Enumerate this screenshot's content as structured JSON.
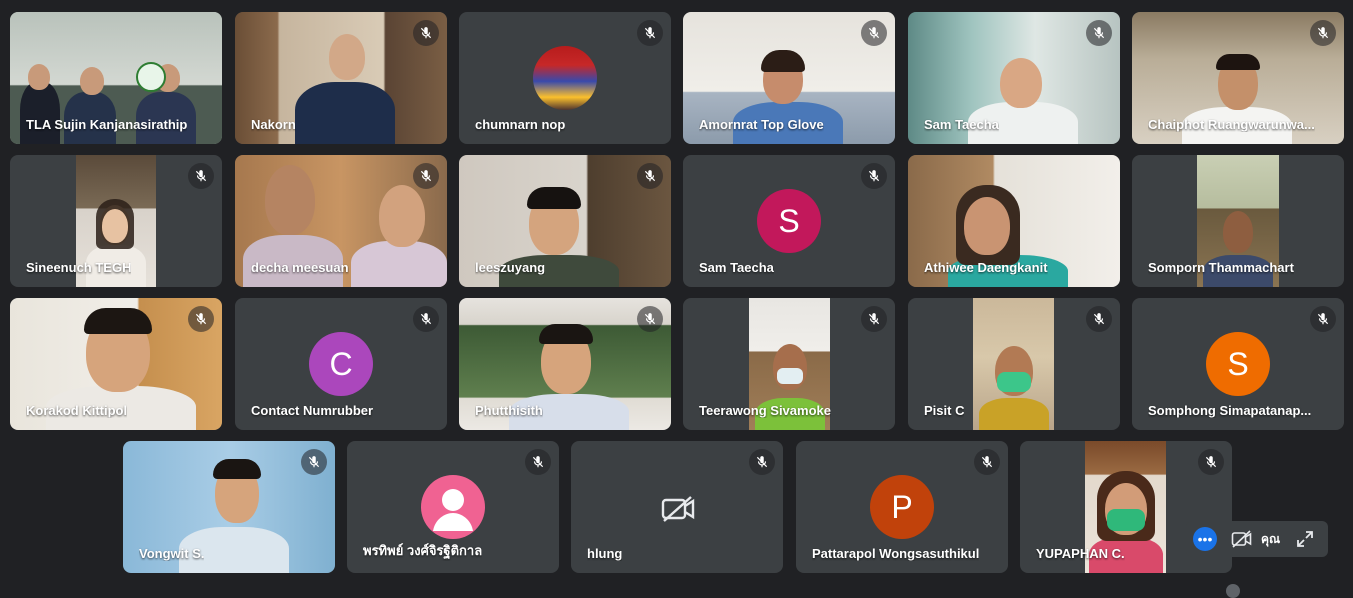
{
  "participants": [
    {
      "name": "TLA Sujin Kanjanasirathip",
      "avatar_letter": "",
      "avatar_color": "",
      "muted": false,
      "video": true
    },
    {
      "name": "Nakorn",
      "avatar_letter": "",
      "avatar_color": "",
      "muted": true,
      "video": true
    },
    {
      "name": "chumnarn nop",
      "avatar_letter": "",
      "avatar_color": "",
      "muted": true,
      "video": false
    },
    {
      "name": "Amornrat Top Glove",
      "avatar_letter": "",
      "avatar_color": "",
      "muted": true,
      "video": true
    },
    {
      "name": "Sam Taecha",
      "avatar_letter": "",
      "avatar_color": "",
      "muted": true,
      "video": true
    },
    {
      "name": "Chaiphot Ruangwarunwa...",
      "avatar_letter": "",
      "avatar_color": "",
      "muted": true,
      "video": true
    },
    {
      "name": "Sineenuch TEGH",
      "avatar_letter": "",
      "avatar_color": "",
      "muted": true,
      "video": true
    },
    {
      "name": "decha meesuan",
      "avatar_letter": "",
      "avatar_color": "",
      "muted": true,
      "video": true
    },
    {
      "name": "leeszuyang",
      "avatar_letter": "",
      "avatar_color": "",
      "muted": true,
      "video": true
    },
    {
      "name": "Sam Taecha",
      "avatar_letter": "S",
      "avatar_color": "#c2185b",
      "muted": true,
      "video": false
    },
    {
      "name": "Athiwee Daengkanit",
      "avatar_letter": "",
      "avatar_color": "",
      "muted": false,
      "video": true
    },
    {
      "name": "Somporn Thammachart",
      "avatar_letter": "",
      "avatar_color": "",
      "muted": false,
      "video": true
    },
    {
      "name": "Korakod Kittipol",
      "avatar_letter": "",
      "avatar_color": "",
      "muted": true,
      "video": true
    },
    {
      "name": "Contact Numrubber",
      "avatar_letter": "C",
      "avatar_color": "#ab47bc",
      "muted": true,
      "video": false
    },
    {
      "name": "Phutthisith",
      "avatar_letter": "",
      "avatar_color": "",
      "muted": true,
      "video": true
    },
    {
      "name": "Teerawong Sivamoke",
      "avatar_letter": "",
      "avatar_color": "",
      "muted": true,
      "video": true
    },
    {
      "name": "Pisit C",
      "avatar_letter": "",
      "avatar_color": "",
      "muted": true,
      "video": true
    },
    {
      "name": "Somphong Simapatanap...",
      "avatar_letter": "S",
      "avatar_color": "#ef6c00",
      "muted": true,
      "video": false
    },
    {
      "name": "Vongwit S.",
      "avatar_letter": "",
      "avatar_color": "",
      "muted": true,
      "video": true
    },
    {
      "name": "พรทิพย์ วงศ์จิรฐิติกาล",
      "avatar_letter": "",
      "avatar_color": "#f06292",
      "muted": true,
      "video": false
    },
    {
      "name": "hlung",
      "avatar_letter": "",
      "avatar_color": "",
      "muted": true,
      "video": false
    },
    {
      "name": "Pattarapol Wongsasuthikul",
      "avatar_letter": "P",
      "avatar_color": "#c1420b",
      "muted": true,
      "video": false
    },
    {
      "name": "YUPAPHAN C.",
      "avatar_letter": "",
      "avatar_color": "",
      "muted": true,
      "video": true
    }
  ],
  "self_view": {
    "label": "คุณ",
    "more_icon": "more-horiz-icon",
    "camera_icon": "videocam-off-icon",
    "expand_icon": "expand-icon"
  },
  "colors": {
    "background": "#202124",
    "tile": "#3c4043",
    "accent": "#1a73e8"
  }
}
